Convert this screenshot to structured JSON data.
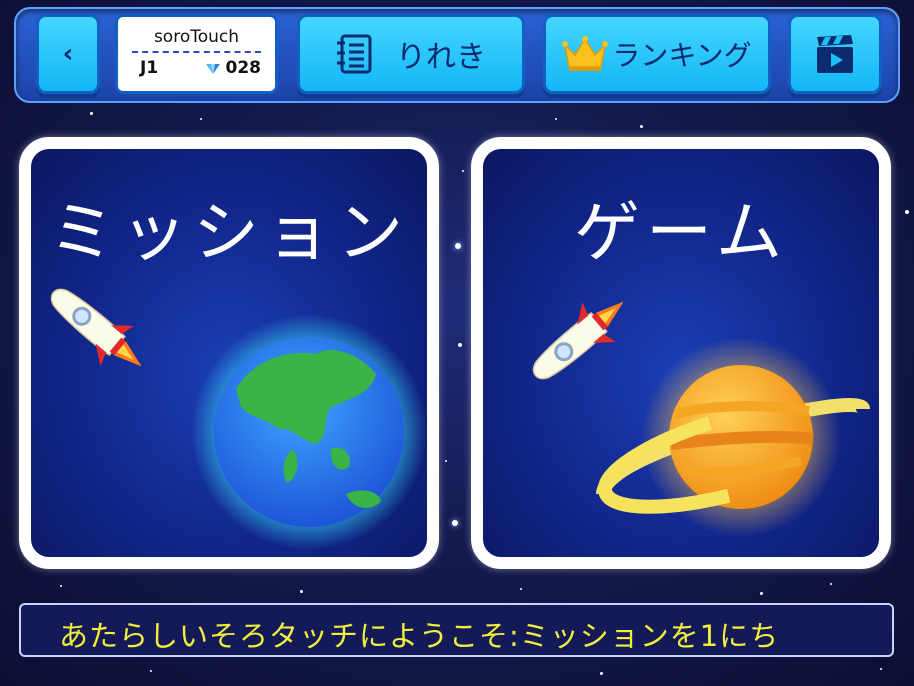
{
  "header": {
    "back_icon": "chevron-left-icon",
    "user": {
      "name": "soroTouch",
      "level": "J1",
      "points": "028"
    },
    "history_label": "りれき",
    "ranking_label": "ランキング",
    "video_icon": "video-clapper-icon"
  },
  "cards": {
    "mission": {
      "title": "ミッション",
      "art": [
        "rocket-icon",
        "earth-icon"
      ]
    },
    "game": {
      "title": "ゲーム",
      "art": [
        "rocket-icon",
        "saturn-icon"
      ]
    }
  },
  "ticker": {
    "text": "あたらしいそろタッチにようこそ:ミッションを1にち"
  },
  "colors": {
    "button": "#1cc0f8",
    "ticker_text": "#f2ee3c",
    "card_bg": "#11268a",
    "topbar": "#2557c8"
  }
}
